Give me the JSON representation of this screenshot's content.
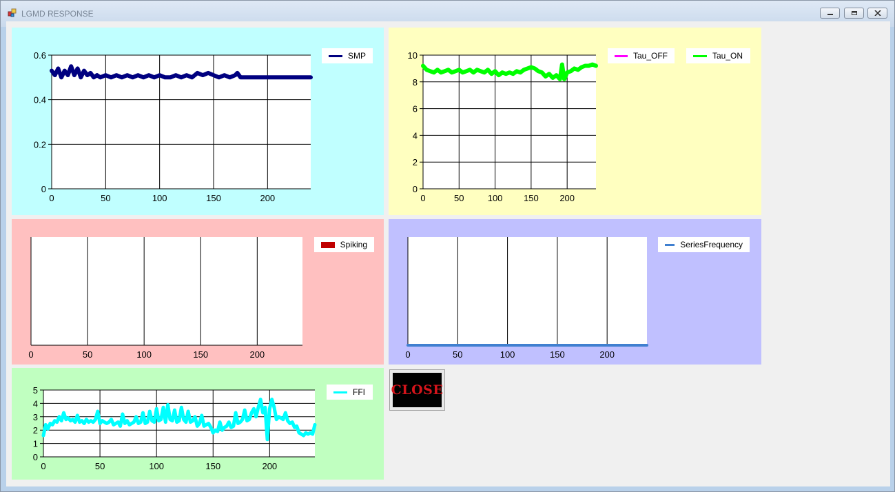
{
  "window": {
    "title": "LGMD RESPONSE"
  },
  "colors": {
    "smp_panel": "#c0ffff",
    "tau_panel": "#ffffc0",
    "spiking_panel": "#ffc0c0",
    "freq_panel": "#c0c0ff",
    "ffi_panel": "#c0ffc0",
    "smp": "#000080",
    "tau_off": "#ff00ff",
    "tau_on": "#00ff00",
    "spiking": "#c00000",
    "series_frequency": "#4080d0",
    "ffi": "#00ffff"
  },
  "chart_data": [
    {
      "name": "smp-chart",
      "type": "line",
      "series": [
        {
          "name": "SMP",
          "color": "#000080",
          "x": [
            0,
            3,
            6,
            9,
            12,
            15,
            18,
            21,
            24,
            27,
            30,
            33,
            36,
            39,
            42,
            45,
            50,
            55,
            60,
            65,
            70,
            75,
            80,
            85,
            90,
            95,
            100,
            105,
            110,
            115,
            120,
            125,
            130,
            135,
            140,
            145,
            150,
            155,
            160,
            165,
            170,
            172,
            175,
            200,
            240
          ],
          "y": [
            0.53,
            0.51,
            0.54,
            0.5,
            0.53,
            0.51,
            0.55,
            0.51,
            0.54,
            0.5,
            0.53,
            0.51,
            0.52,
            0.5,
            0.51,
            0.5,
            0.51,
            0.5,
            0.51,
            0.5,
            0.51,
            0.5,
            0.51,
            0.5,
            0.51,
            0.5,
            0.51,
            0.5,
            0.5,
            0.51,
            0.5,
            0.51,
            0.5,
            0.52,
            0.51,
            0.52,
            0.51,
            0.5,
            0.51,
            0.5,
            0.51,
            0.52,
            0.5,
            0.5,
            0.5
          ]
        }
      ],
      "xlim": [
        0,
        240
      ],
      "ylim": [
        0,
        0.6
      ],
      "xticks": [
        "0",
        "50",
        "100",
        "150",
        "200"
      ],
      "yticks": [
        "0",
        "0.2",
        "0.4",
        "0.6"
      ]
    },
    {
      "name": "tau-chart",
      "type": "line",
      "series": [
        {
          "name": "Tau_OFF",
          "color": "#ff00ff",
          "x": [],
          "y": []
        },
        {
          "name": "Tau_ON",
          "color": "#00ff00",
          "x": [
            0,
            5,
            10,
            15,
            20,
            25,
            30,
            35,
            40,
            45,
            50,
            55,
            60,
            65,
            70,
            75,
            80,
            85,
            90,
            95,
            100,
            105,
            110,
            115,
            120,
            125,
            130,
            135,
            140,
            145,
            150,
            155,
            160,
            165,
            170,
            175,
            180,
            185,
            190,
            193,
            196,
            200,
            205,
            210,
            215,
            220,
            225,
            230,
            235,
            240
          ],
          "y": [
            9.2,
            8.9,
            8.8,
            8.7,
            8.9,
            8.7,
            8.8,
            8.9,
            8.7,
            8.8,
            8.9,
            8.7,
            8.8,
            8.9,
            8.7,
            8.9,
            8.8,
            8.7,
            8.9,
            8.6,
            8.8,
            8.5,
            8.7,
            8.6,
            8.7,
            8.6,
            8.8,
            8.7,
            8.9,
            9.0,
            9.1,
            9.0,
            8.8,
            8.7,
            8.4,
            8.6,
            8.3,
            8.5,
            8.2,
            9.3,
            8.2,
            8.7,
            8.8,
            9.0,
            8.9,
            9.1,
            9.2,
            9.2,
            9.3,
            9.2
          ]
        }
      ],
      "xlim": [
        0,
        240
      ],
      "ylim": [
        0,
        10
      ],
      "xticks": [
        "0",
        "50",
        "100",
        "150",
        "200"
      ],
      "yticks": [
        "0",
        "2",
        "4",
        "6",
        "8",
        "10"
      ]
    },
    {
      "name": "spiking-chart",
      "type": "bar",
      "series": [
        {
          "name": "Spiking",
          "color": "#c00000",
          "x": [],
          "y": []
        }
      ],
      "xlim": [
        0,
        240
      ],
      "xticks": [
        "0",
        "50",
        "100",
        "150",
        "200"
      ]
    },
    {
      "name": "frequency-chart",
      "type": "line",
      "series": [
        {
          "name": "SeriesFrequency",
          "color": "#4080d0",
          "x": [
            0,
            240
          ],
          "y": [
            0,
            0
          ]
        }
      ],
      "xlim": [
        0,
        240
      ],
      "xticks": [
        "0",
        "50",
        "100",
        "150",
        "200"
      ]
    },
    {
      "name": "ffi-chart",
      "type": "line",
      "series": [
        {
          "name": "FFI",
          "color": "#00ffff",
          "x": [
            0,
            2,
            4,
            6,
            8,
            10,
            12,
            14,
            16,
            18,
            20,
            22,
            24,
            26,
            28,
            30,
            32,
            34,
            36,
            38,
            40,
            42,
            44,
            46,
            48,
            50,
            52,
            54,
            56,
            58,
            60,
            62,
            64,
            66,
            68,
            70,
            72,
            74,
            76,
            78,
            80,
            82,
            84,
            86,
            88,
            90,
            92,
            94,
            96,
            98,
            100,
            102,
            104,
            106,
            108,
            110,
            112,
            114,
            116,
            118,
            120,
            122,
            124,
            126,
            128,
            130,
            132,
            134,
            136,
            138,
            140,
            142,
            144,
            146,
            148,
            150,
            152,
            154,
            156,
            158,
            160,
            162,
            164,
            166,
            168,
            170,
            172,
            174,
            176,
            178,
            180,
            182,
            184,
            186,
            188,
            190,
            192,
            194,
            196,
            198,
            200,
            202,
            204,
            206,
            208,
            210,
            212,
            214,
            216,
            218,
            220,
            222,
            224,
            226,
            228,
            230,
            232,
            234,
            236,
            238,
            240
          ],
          "y": [
            1.6,
            2.4,
            2.1,
            2.5,
            2.4,
            2.7,
            2.6,
            3.0,
            2.7,
            3.3,
            2.8,
            2.9,
            2.7,
            2.8,
            2.6,
            3.1,
            2.6,
            2.7,
            2.5,
            2.8,
            2.6,
            2.7,
            2.6,
            2.8,
            3.4,
            2.5,
            2.7,
            2.6,
            2.5,
            2.6,
            2.8,
            2.4,
            2.5,
            2.6,
            2.3,
            3.2,
            2.5,
            2.7,
            2.4,
            2.5,
            2.6,
            3.0,
            2.5,
            2.6,
            3.3,
            2.5,
            2.6,
            3.4,
            2.7,
            2.6,
            3.6,
            2.7,
            2.8,
            3.7,
            2.6,
            3.9,
            2.8,
            2.7,
            3.5,
            2.6,
            2.7,
            3.7,
            2.8,
            2.6,
            3.4,
            2.6,
            2.7,
            3.0,
            2.3,
            2.5,
            3.1,
            2.3,
            2.4,
            2.5,
            2.2,
            1.8,
            2.0,
            1.9,
            2.6,
            2.0,
            2.2,
            2.3,
            2.6,
            2.2,
            2.3,
            3.3,
            2.5,
            2.6,
            2.8,
            3.5,
            2.7,
            2.8,
            3.3,
            3.6,
            3.0,
            3.7,
            4.3,
            3.3,
            3.7,
            1.3,
            3.6,
            4.3,
            3.7,
            2.8,
            3.0,
            2.9,
            2.8,
            3.3,
            2.7,
            2.5,
            2.6,
            2.2,
            2.3,
            1.8,
            1.7,
            1.6,
            1.8,
            1.7,
            1.8,
            1.7,
            2.4
          ]
        }
      ],
      "xlim": [
        0,
        240
      ],
      "ylim": [
        0,
        5
      ],
      "xticks": [
        "0",
        "50",
        "100",
        "150",
        "200"
      ],
      "yticks": [
        "0",
        "1",
        "2",
        "3",
        "4",
        "5"
      ]
    }
  ],
  "legends": {
    "smp": "SMP",
    "tau_off": "Tau_OFF",
    "tau_on": "Tau_ON",
    "spiking": "Spiking",
    "frequency": "SeriesFrequency",
    "ffi": "FFI"
  },
  "close_button": {
    "label": "CLOSE"
  }
}
